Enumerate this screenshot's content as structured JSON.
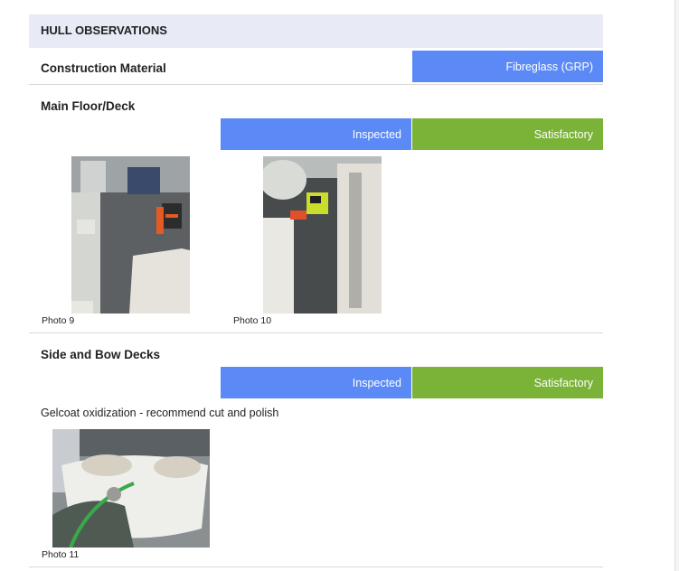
{
  "section": {
    "title": "HULL OBSERVATIONS"
  },
  "construction": {
    "label": "Construction Material",
    "value": "Fibreglass (GRP)"
  },
  "main_floor": {
    "label": "Main Floor/Deck",
    "status": "Inspected",
    "condition": "Satisfactory",
    "photos": [
      {
        "caption": "Photo 9",
        "icon": "boat-floor-photo"
      },
      {
        "caption": "Photo 10",
        "icon": "boat-floor-photo"
      }
    ]
  },
  "side_bow": {
    "label": "Side and Bow Decks",
    "status": "Inspected",
    "condition": "Satisfactory",
    "note": "Gelcoat oxidization - recommend cut and polish",
    "photos": [
      {
        "caption": "Photo 11",
        "icon": "boat-bow-photo"
      }
    ]
  },
  "colors": {
    "inspected": "#5b8af7",
    "satisfactory": "#7ab338",
    "header_bg": "#e8ebf6"
  }
}
